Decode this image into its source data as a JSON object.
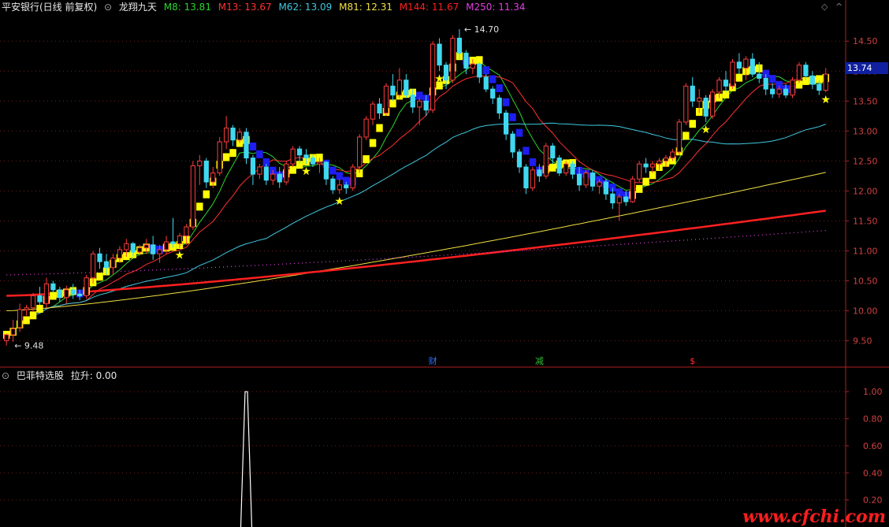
{
  "header": {
    "title": "平安银行(日线 前复权)",
    "indicator_name": "龙翔九天",
    "ma": [
      {
        "label": "M8: 13.81",
        "color": "#2bd42b"
      },
      {
        "label": "M13: 13.67",
        "color": "#ff3030"
      },
      {
        "label": "M62: 13.09",
        "color": "#40c8e0"
      },
      {
        "label": "M81: 12.31",
        "color": "#f0e040"
      },
      {
        "label": "M144: 11.67",
        "color": "#ff2020"
      },
      {
        "label": "M250: 11.34",
        "color": "#e040e0"
      }
    ]
  },
  "sub_header": {
    "name": "巴菲特选股",
    "value_label": "拉升: 0.00"
  },
  "price_marker": {
    "value": "13.74"
  },
  "high_label": "14.70",
  "low_label": "9.48",
  "events": [
    {
      "text": "财",
      "color": "#3070ff"
    },
    {
      "text": "减",
      "color": "#30c030"
    },
    {
      "text": "$",
      "color": "#ff3030"
    }
  ],
  "watermark": "www.cfchi.com",
  "colors": {
    "up": "#ff3c3c",
    "down": "#40d8f0",
    "axis": "#b02020",
    "grid": "#702020",
    "ribbon_up": "#ffff00",
    "ribbon_down": "#1e1ef0",
    "star": "#ffff00"
  },
  "chart_data": [
    {
      "type": "candlestick",
      "title": "龙翔九天",
      "y_ticks": [
        "14.50",
        "14.00",
        "13.50",
        "13.00",
        "12.50",
        "12.00",
        "11.50",
        "11.00",
        "10.50",
        "10.00",
        "9.50"
      ],
      "ylim": [
        9.1,
        14.95
      ],
      "ohlc": [
        [
          9.5,
          9.62,
          9.42,
          9.6
        ],
        [
          9.6,
          9.85,
          9.48,
          9.7
        ],
        [
          9.72,
          10.12,
          9.65,
          10.02
        ],
        [
          10.02,
          10.1,
          9.92,
          10.05
        ],
        [
          10.05,
          10.3,
          9.98,
          10.25
        ],
        [
          10.25,
          10.4,
          10.1,
          10.15
        ],
        [
          10.12,
          10.55,
          10.05,
          10.45
        ],
        [
          10.45,
          10.5,
          10.3,
          10.35
        ],
        [
          10.35,
          10.4,
          10.15,
          10.22
        ],
        [
          10.22,
          10.42,
          10.12,
          10.35
        ],
        [
          10.35,
          10.45,
          10.2,
          10.28
        ],
        [
          10.28,
          10.35,
          10.18,
          10.25
        ],
        [
          10.25,
          10.6,
          10.2,
          10.55
        ],
        [
          10.55,
          11,
          10.45,
          10.95
        ],
        [
          10.95,
          11.05,
          10.7,
          10.82
        ],
        [
          10.82,
          10.95,
          10.6,
          10.72
        ],
        [
          10.72,
          10.95,
          10.6,
          10.88
        ],
        [
          10.88,
          11.08,
          10.8,
          11.02
        ],
        [
          11.02,
          11.2,
          10.9,
          11.12
        ],
        [
          11.12,
          11.15,
          10.9,
          10.98
        ],
        [
          10.98,
          11.1,
          10.92,
          11.05
        ],
        [
          11.05,
          11.2,
          10.95,
          11.1
        ],
        [
          11.1,
          11.25,
          10.85,
          10.95
        ],
        [
          10.95,
          11.1,
          10.8,
          11.02
        ],
        [
          11.02,
          11.25,
          10.95,
          11.15
        ],
        [
          11.15,
          11.55,
          11.05,
          11.12
        ],
        [
          11.12,
          11.3,
          11.05,
          11.25
        ],
        [
          11.25,
          11.45,
          11.1,
          11.4
        ],
        [
          11.4,
          12.5,
          11.35,
          12.42
        ],
        [
          12.42,
          12.6,
          12.1,
          12.5
        ],
        [
          12.5,
          12.55,
          12.05,
          12.15
        ],
        [
          12.15,
          12.4,
          12.05,
          12.3
        ],
        [
          12.3,
          12.9,
          12.25,
          12.82
        ],
        [
          12.82,
          13.25,
          12.7,
          13.05
        ],
        [
          13.05,
          13.1,
          12.75,
          12.85
        ],
        [
          12.85,
          13.05,
          12.8,
          12.98
        ],
        [
          12.98,
          13.05,
          12.45,
          12.55
        ],
        [
          12.55,
          12.6,
          12.1,
          12.28
        ],
        [
          12.28,
          12.45,
          12.2,
          12.4
        ],
        [
          12.4,
          12.45,
          12.1,
          12.18
        ],
        [
          12.18,
          12.35,
          12.1,
          12.28
        ],
        [
          12.28,
          12.4,
          12.05,
          12.15
        ],
        [
          12.15,
          12.5,
          12.1,
          12.45
        ],
        [
          12.45,
          12.75,
          12.4,
          12.7
        ],
        [
          12.7,
          12.75,
          12.45,
          12.6
        ],
        [
          12.6,
          12.7,
          12.45,
          12.55
        ],
        [
          12.55,
          12.6,
          12.4,
          12.45
        ],
        [
          12.45,
          12.55,
          12.3,
          12.48
        ],
        [
          12.48,
          12.5,
          12.1,
          12.2
        ],
        [
          12.2,
          12.25,
          11.95,
          12.02
        ],
        [
          12.02,
          12.2,
          11.95,
          12.1
        ],
        [
          12.1,
          12.15,
          11.95,
          12.05
        ],
        [
          12.05,
          12.45,
          12.0,
          12.4
        ],
        [
          12.4,
          12.95,
          12.3,
          12.9
        ],
        [
          12.9,
          13.25,
          12.85,
          13.2
        ],
        [
          13.2,
          13.5,
          13.1,
          13.45
        ],
        [
          13.45,
          13.55,
          13.2,
          13.3
        ],
        [
          13.3,
          13.8,
          13.25,
          13.75
        ],
        [
          13.75,
          13.95,
          13.5,
          13.6
        ],
        [
          13.6,
          14.05,
          13.55,
          13.85
        ],
        [
          13.85,
          13.95,
          13.55,
          13.6
        ],
        [
          13.6,
          13.7,
          13.3,
          13.4
        ],
        [
          13.4,
          13.55,
          13.1,
          13.5
        ],
        [
          13.5,
          13.6,
          13.25,
          13.35
        ],
        [
          13.35,
          14.5,
          13.3,
          14.45
        ],
        [
          14.45,
          14.55,
          14.0,
          14.1
        ],
        [
          14.1,
          14.15,
          13.7,
          13.85
        ],
        [
          13.85,
          14.6,
          13.8,
          14.55
        ],
        [
          14.55,
          14.7,
          14.2,
          14.3
        ],
        [
          14.3,
          14.35,
          13.95,
          14.05
        ],
        [
          14.05,
          14.2,
          13.95,
          14.12
        ],
        [
          14.12,
          14.15,
          13.8,
          13.9
        ],
        [
          13.9,
          13.95,
          13.65,
          13.7
        ],
        [
          13.7,
          13.75,
          13.45,
          13.55
        ],
        [
          13.55,
          13.6,
          13.2,
          13.3
        ],
        [
          13.3,
          13.35,
          12.85,
          12.95
        ],
        [
          12.95,
          13.0,
          12.55,
          12.65
        ],
        [
          12.65,
          12.7,
          12.3,
          12.4
        ],
        [
          12.4,
          12.45,
          11.95,
          12.05
        ],
        [
          12.05,
          12.4,
          12.0,
          12.35
        ],
        [
          12.35,
          12.45,
          12.15,
          12.25
        ],
        [
          12.25,
          12.8,
          12.2,
          12.75
        ],
        [
          12.75,
          12.8,
          12.45,
          12.55
        ],
        [
          12.55,
          12.6,
          12.25,
          12.3
        ],
        [
          12.3,
          12.5,
          12.25,
          12.45
        ],
        [
          12.45,
          12.5,
          12.2,
          12.28
        ],
        [
          12.28,
          12.4,
          12.0,
          12.1
        ],
        [
          12.1,
          12.35,
          12.05,
          12.3
        ],
        [
          12.3,
          12.35,
          12.0,
          12.08
        ],
        [
          12.08,
          12.2,
          11.95,
          12.15
        ],
        [
          12.15,
          12.2,
          11.85,
          11.95
        ],
        [
          11.95,
          12.05,
          11.7,
          11.8
        ],
        [
          11.8,
          11.95,
          11.5,
          11.9
        ],
        [
          11.9,
          12.0,
          11.75,
          11.82
        ],
        [
          11.82,
          12.25,
          11.8,
          12.2
        ],
        [
          12.2,
          12.5,
          12.15,
          12.45
        ],
        [
          12.45,
          12.55,
          12.3,
          12.4
        ],
        [
          12.4,
          12.5,
          12.3,
          12.45
        ],
        [
          12.45,
          12.55,
          12.35,
          12.5
        ],
        [
          12.5,
          12.6,
          12.4,
          12.55
        ],
        [
          12.55,
          12.7,
          12.5,
          12.65
        ],
        [
          12.65,
          13.2,
          12.6,
          13.15
        ],
        [
          13.15,
          13.8,
          13.1,
          13.75
        ],
        [
          13.75,
          13.9,
          13.4,
          13.5
        ],
        [
          13.5,
          13.7,
          13.3,
          13.55
        ],
        [
          13.55,
          13.6,
          13.15,
          13.25
        ],
        [
          13.25,
          13.7,
          13.2,
          13.65
        ],
        [
          13.65,
          13.9,
          13.55,
          13.85
        ],
        [
          13.85,
          14.0,
          13.65,
          13.75
        ],
        [
          13.75,
          14.2,
          13.7,
          14.15
        ],
        [
          14.15,
          14.3,
          13.95,
          14.05
        ],
        [
          14.05,
          14.25,
          13.85,
          14.2
        ],
        [
          14.2,
          14.3,
          13.9,
          13.95
        ],
        [
          13.95,
          14.15,
          13.8,
          13.88
        ],
        [
          13.88,
          13.95,
          13.6,
          13.7
        ],
        [
          13.7,
          13.8,
          13.55,
          13.62
        ],
        [
          13.62,
          13.75,
          13.55,
          13.7
        ],
        [
          13.7,
          13.78,
          13.55,
          13.6
        ],
        [
          13.6,
          13.9,
          13.55,
          13.85
        ],
        [
          13.85,
          14.15,
          13.8,
          14.1
        ],
        [
          14.1,
          14.15,
          13.85,
          13.92
        ],
        [
          13.92,
          14.0,
          13.7,
          13.78
        ],
        [
          13.78,
          13.85,
          13.6,
          13.68
        ],
        [
          13.68,
          14.05,
          13.65,
          13.95
        ]
      ],
      "ma_series_names": [
        "M8",
        "M13",
        "M62",
        "M81",
        "M144",
        "M250"
      ]
    },
    {
      "type": "line",
      "title": "巴菲特选股",
      "y_ticks": [
        "1.00",
        "0.80",
        "0.60",
        "0.40",
        "0.20"
      ],
      "ylim": [
        0,
        1.1
      ],
      "series": [
        {
          "name": "拉升",
          "peak_index": 36,
          "peak_value": 1.0,
          "last_value": 0.0
        }
      ]
    }
  ]
}
